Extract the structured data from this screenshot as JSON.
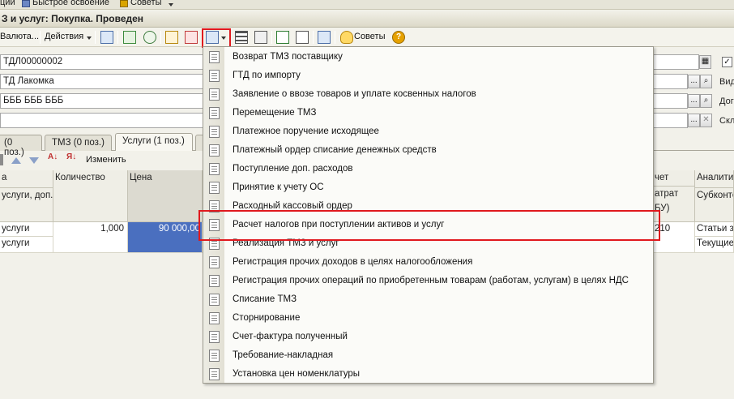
{
  "top_strip": {
    "item1": "ции",
    "item2": "Быстрое освоение",
    "item3": "Советы"
  },
  "window": {
    "title": "З и услуг: Покупка. Проведен"
  },
  "toolbar": {
    "currency_button": "Валюта...",
    "actions_button": "Действия",
    "tips_button": "Советы",
    "help_label": "?"
  },
  "form": {
    "number_value": "ТДЛ00000002",
    "counterparty_value": "ТД Лакомка",
    "contract_value": "БББ БББ БББ",
    "empty_field_value": "",
    "side_label_1": "Вид",
    "side_label_2": "Дог",
    "side_label_3": "Скл",
    "lookup_button": "...",
    "clear_button": "✕",
    "checkbox_mark": "✓"
  },
  "tabs": [
    {
      "label": "(0 поз.)"
    },
    {
      "label": "ТМЗ (0 поз.)"
    },
    {
      "label": "Услуги (1 поз.)"
    }
  ],
  "table_toolbar": {
    "edit_button": "Изменить"
  },
  "table": {
    "headers": {
      "col_a_top": "а",
      "col_a_bottom": "услуги, доп.",
      "quantity": "Количество",
      "price": "Цена",
      "account_top": "чет",
      "account_bottom": "атрат",
      "account_third": "БУ)",
      "analytics_top": "Аналити",
      "analytics_bottom": "Субконто"
    },
    "row1": {
      "col_a": "услуги",
      "quantity": "1,000",
      "price": "90 000,00",
      "account": "210",
      "analytics": "Статьи з"
    },
    "row2": {
      "col_a": "услуги",
      "analytics": "Текущие"
    }
  },
  "dropdown_menu": {
    "items": [
      "Возврат ТМЗ поставщику",
      "ГТД по импорту",
      "Заявление о ввозе товаров и уплате косвенных налогов",
      "Перемещение ТМЗ",
      "Платежное поручение исходящее",
      "Платежный ордер списание денежных средств",
      "Поступление доп. расходов",
      "Принятие к учету ОС",
      "Расходный кассовый ордер",
      "Расчет налогов при поступлении активов и услуг",
      "Реализация ТМЗ и услуг",
      "Регистрация прочих доходов в целях налогообложения",
      "Регистрация прочих операций по приобретенным товарам (работам, услугам) в целях НДС",
      "Списание ТМЗ",
      "Сторнирование",
      "Счет-фактура полученный",
      "Требование-накладная",
      "Установка цен номенклатуры"
    ]
  },
  "highlight_color": "#e0191e",
  "selection_color": "#4a6fbf"
}
